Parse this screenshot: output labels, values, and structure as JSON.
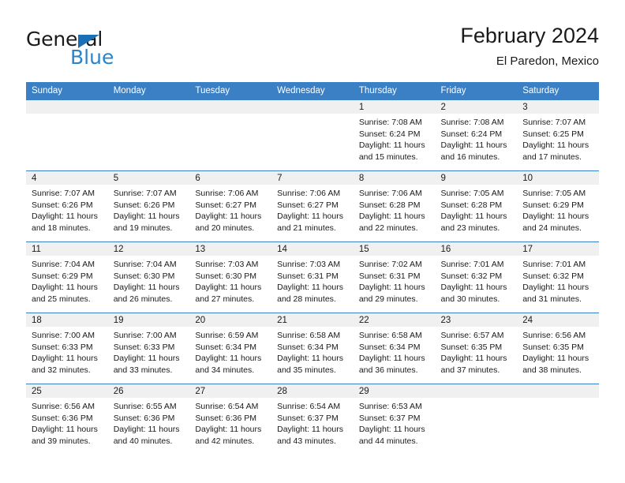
{
  "brand": {
    "name_top": "General",
    "name_bottom": "Blue",
    "triangle_color": "#1a6fb5",
    "blue_color": "#2a84cc"
  },
  "header": {
    "title": "February 2024",
    "subtitle": "El Paredon, Mexico"
  },
  "theme": {
    "header_blue": "#3b7fc4",
    "daynum_band": "#f0f0f0",
    "text": "#1a1a1a"
  },
  "weekday_headers": [
    "Sunday",
    "Monday",
    "Tuesday",
    "Wednesday",
    "Thursday",
    "Friday",
    "Saturday"
  ],
  "labels": {
    "sunrise_prefix": "Sunrise:",
    "sunset_prefix": "Sunset:",
    "daylight_prefix": "Daylight:"
  },
  "weeks": [
    [
      {
        "day": "",
        "l1": "",
        "l2": "",
        "l3": "",
        "l4": ""
      },
      {
        "day": "",
        "l1": "",
        "l2": "",
        "l3": "",
        "l4": ""
      },
      {
        "day": "",
        "l1": "",
        "l2": "",
        "l3": "",
        "l4": ""
      },
      {
        "day": "",
        "l1": "",
        "l2": "",
        "l3": "",
        "l4": ""
      },
      {
        "day": "1",
        "l1": "Sunrise: 7:08 AM",
        "l2": "Sunset: 6:24 PM",
        "l3": "Daylight: 11 hours",
        "l4": "and 15 minutes."
      },
      {
        "day": "2",
        "l1": "Sunrise: 7:08 AM",
        "l2": "Sunset: 6:24 PM",
        "l3": "Daylight: 11 hours",
        "l4": "and 16 minutes."
      },
      {
        "day": "3",
        "l1": "Sunrise: 7:07 AM",
        "l2": "Sunset: 6:25 PM",
        "l3": "Daylight: 11 hours",
        "l4": "and 17 minutes."
      }
    ],
    [
      {
        "day": "4",
        "l1": "Sunrise: 7:07 AM",
        "l2": "Sunset: 6:26 PM",
        "l3": "Daylight: 11 hours",
        "l4": "and 18 minutes."
      },
      {
        "day": "5",
        "l1": "Sunrise: 7:07 AM",
        "l2": "Sunset: 6:26 PM",
        "l3": "Daylight: 11 hours",
        "l4": "and 19 minutes."
      },
      {
        "day": "6",
        "l1": "Sunrise: 7:06 AM",
        "l2": "Sunset: 6:27 PM",
        "l3": "Daylight: 11 hours",
        "l4": "and 20 minutes."
      },
      {
        "day": "7",
        "l1": "Sunrise: 7:06 AM",
        "l2": "Sunset: 6:27 PM",
        "l3": "Daylight: 11 hours",
        "l4": "and 21 minutes."
      },
      {
        "day": "8",
        "l1": "Sunrise: 7:06 AM",
        "l2": "Sunset: 6:28 PM",
        "l3": "Daylight: 11 hours",
        "l4": "and 22 minutes."
      },
      {
        "day": "9",
        "l1": "Sunrise: 7:05 AM",
        "l2": "Sunset: 6:28 PM",
        "l3": "Daylight: 11 hours",
        "l4": "and 23 minutes."
      },
      {
        "day": "10",
        "l1": "Sunrise: 7:05 AM",
        "l2": "Sunset: 6:29 PM",
        "l3": "Daylight: 11 hours",
        "l4": "and 24 minutes."
      }
    ],
    [
      {
        "day": "11",
        "l1": "Sunrise: 7:04 AM",
        "l2": "Sunset: 6:29 PM",
        "l3": "Daylight: 11 hours",
        "l4": "and 25 minutes."
      },
      {
        "day": "12",
        "l1": "Sunrise: 7:04 AM",
        "l2": "Sunset: 6:30 PM",
        "l3": "Daylight: 11 hours",
        "l4": "and 26 minutes."
      },
      {
        "day": "13",
        "l1": "Sunrise: 7:03 AM",
        "l2": "Sunset: 6:30 PM",
        "l3": "Daylight: 11 hours",
        "l4": "and 27 minutes."
      },
      {
        "day": "14",
        "l1": "Sunrise: 7:03 AM",
        "l2": "Sunset: 6:31 PM",
        "l3": "Daylight: 11 hours",
        "l4": "and 28 minutes."
      },
      {
        "day": "15",
        "l1": "Sunrise: 7:02 AM",
        "l2": "Sunset: 6:31 PM",
        "l3": "Daylight: 11 hours",
        "l4": "and 29 minutes."
      },
      {
        "day": "16",
        "l1": "Sunrise: 7:01 AM",
        "l2": "Sunset: 6:32 PM",
        "l3": "Daylight: 11 hours",
        "l4": "and 30 minutes."
      },
      {
        "day": "17",
        "l1": "Sunrise: 7:01 AM",
        "l2": "Sunset: 6:32 PM",
        "l3": "Daylight: 11 hours",
        "l4": "and 31 minutes."
      }
    ],
    [
      {
        "day": "18",
        "l1": "Sunrise: 7:00 AM",
        "l2": "Sunset: 6:33 PM",
        "l3": "Daylight: 11 hours",
        "l4": "and 32 minutes."
      },
      {
        "day": "19",
        "l1": "Sunrise: 7:00 AM",
        "l2": "Sunset: 6:33 PM",
        "l3": "Daylight: 11 hours",
        "l4": "and 33 minutes."
      },
      {
        "day": "20",
        "l1": "Sunrise: 6:59 AM",
        "l2": "Sunset: 6:34 PM",
        "l3": "Daylight: 11 hours",
        "l4": "and 34 minutes."
      },
      {
        "day": "21",
        "l1": "Sunrise: 6:58 AM",
        "l2": "Sunset: 6:34 PM",
        "l3": "Daylight: 11 hours",
        "l4": "and 35 minutes."
      },
      {
        "day": "22",
        "l1": "Sunrise: 6:58 AM",
        "l2": "Sunset: 6:34 PM",
        "l3": "Daylight: 11 hours",
        "l4": "and 36 minutes."
      },
      {
        "day": "23",
        "l1": "Sunrise: 6:57 AM",
        "l2": "Sunset: 6:35 PM",
        "l3": "Daylight: 11 hours",
        "l4": "and 37 minutes."
      },
      {
        "day": "24",
        "l1": "Sunrise: 6:56 AM",
        "l2": "Sunset: 6:35 PM",
        "l3": "Daylight: 11 hours",
        "l4": "and 38 minutes."
      }
    ],
    [
      {
        "day": "25",
        "l1": "Sunrise: 6:56 AM",
        "l2": "Sunset: 6:36 PM",
        "l3": "Daylight: 11 hours",
        "l4": "and 39 minutes."
      },
      {
        "day": "26",
        "l1": "Sunrise: 6:55 AM",
        "l2": "Sunset: 6:36 PM",
        "l3": "Daylight: 11 hours",
        "l4": "and 40 minutes."
      },
      {
        "day": "27",
        "l1": "Sunrise: 6:54 AM",
        "l2": "Sunset: 6:36 PM",
        "l3": "Daylight: 11 hours",
        "l4": "and 42 minutes."
      },
      {
        "day": "28",
        "l1": "Sunrise: 6:54 AM",
        "l2": "Sunset: 6:37 PM",
        "l3": "Daylight: 11 hours",
        "l4": "and 43 minutes."
      },
      {
        "day": "29",
        "l1": "Sunrise: 6:53 AM",
        "l2": "Sunset: 6:37 PM",
        "l3": "Daylight: 11 hours",
        "l4": "and 44 minutes."
      },
      {
        "day": "",
        "l1": "",
        "l2": "",
        "l3": "",
        "l4": ""
      },
      {
        "day": "",
        "l1": "",
        "l2": "",
        "l3": "",
        "l4": ""
      }
    ]
  ]
}
